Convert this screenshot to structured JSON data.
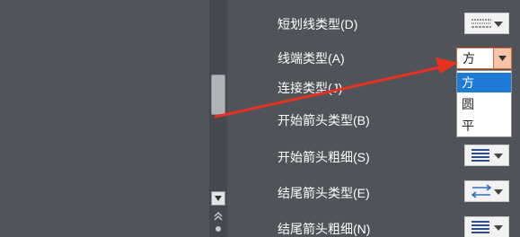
{
  "panel": {
    "rows": [
      {
        "label": "短划线类型(D)"
      },
      {
        "label": "线端类型(A)"
      },
      {
        "label": "连接类型(J)"
      },
      {
        "label": "开始箭头类型(B)"
      },
      {
        "label": "开始箭头粗细(S)"
      },
      {
        "label": "结尾箭头类型(E)"
      },
      {
        "label": "结尾箭头粗细(N)"
      }
    ]
  },
  "cap_type": {
    "selected": "方",
    "options": [
      "方",
      "圆",
      "平"
    ]
  },
  "icons": {
    "dash_type": "dash-style-icon",
    "begin_arrow_size": "line-weight-icon",
    "end_arrow_type": "arrow-type-icon",
    "end_arrow_size": "line-weight-icon",
    "combo_arrow": "chevron-down-icon"
  },
  "colors": {
    "annotation_arrow": "#e8321f",
    "combo_border": "#e4652f",
    "selected_option": "#1e7bd6",
    "background": "#505359"
  }
}
